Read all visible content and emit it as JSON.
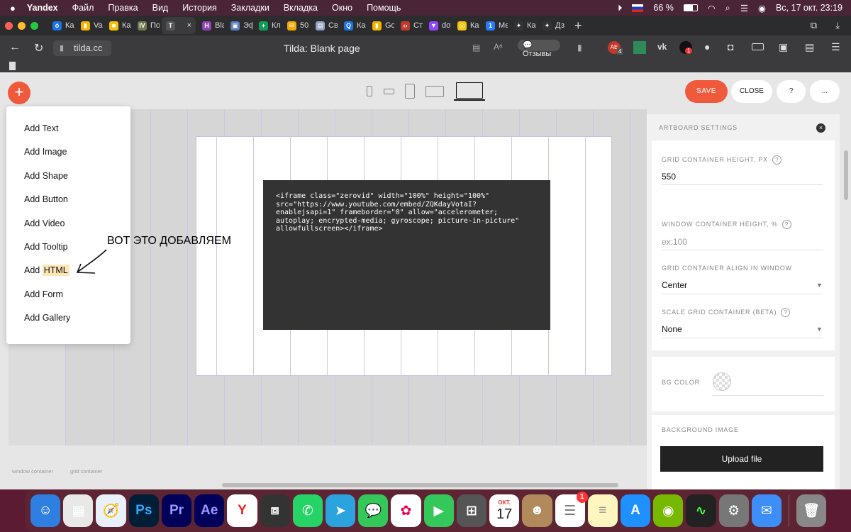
{
  "menubar": {
    "app": "Yandex",
    "items": [
      "Файл",
      "Правка",
      "Вид",
      "История",
      "Закладки",
      "Вкладка",
      "Окно",
      "Помощь"
    ],
    "battery": "66 %",
    "clock": "Вс, 17 окт.  23:19"
  },
  "tabs": [
    {
      "label": "Ка",
      "color": "#1a73e8",
      "glyph": "ó"
    },
    {
      "label": "Vac",
      "color": "#f4b400",
      "glyph": "▮"
    },
    {
      "label": "Ка",
      "color": "#f4c20d",
      "glyph": "■"
    },
    {
      "label": "По",
      "color": "#6d7a4a",
      "glyph": "IV"
    },
    {
      "label": "",
      "color": "#555",
      "glyph": "T",
      "active": true
    },
    {
      "label": "Bla",
      "color": "#8e44ad",
      "glyph": "H"
    },
    {
      "label": "Эф",
      "color": "#5b7db8",
      "glyph": "▣"
    },
    {
      "label": "Кл",
      "color": "#0f9d58",
      "glyph": "+"
    },
    {
      "label": "50",
      "color": "#f2a900",
      "glyph": "✉"
    },
    {
      "label": "Сво",
      "color": "#8fa3c2",
      "glyph": "▤"
    },
    {
      "label": "Ка",
      "color": "#1a73e8",
      "glyph": "Q"
    },
    {
      "label": "Go",
      "color": "#f4b400",
      "glyph": "▮"
    },
    {
      "label": "Ста",
      "color": "#c0392b",
      "glyph": "‹›"
    },
    {
      "label": "dot",
      "color": "#9146ff",
      "glyph": "▼"
    },
    {
      "label": "Ка",
      "color": "#f4c20d",
      "glyph": "◎"
    },
    {
      "label": "Ме",
      "color": "#2979ff",
      "glyph": "1"
    },
    {
      "label": "Ка",
      "color": "#333",
      "glyph": "✦"
    },
    {
      "label": "Дз",
      "color": "#333",
      "glyph": "✦"
    }
  ],
  "address": {
    "url": "tilda.cc",
    "title": "Tilda: Blank page",
    "reviews": "Отзывы"
  },
  "ext_badges": {
    "ae": "4",
    "ext2": "1"
  },
  "app": {
    "save": "SAVE",
    "close": "CLOSE",
    "help": "?",
    "more": "...",
    "add_menu": [
      "Add Text",
      "Add Image",
      "Add Shape",
      "Add Button",
      "Add Video",
      "Add Tooltip",
      "Add HTML",
      "Add Form",
      "Add Gallery"
    ],
    "add_html_prefix": "Add ",
    "add_html_highlight": "HTML",
    "annotation": "ВОТ ЭТО ДОБАВЛЯЕМ",
    "code": "<iframe class=\"zerovid\" width=\"100%\" height=\"100%\"\nsrc=\"https://www.youtube.com/embed/ZQKdayVotaI?\nenablejsapi=1\" frameborder=\"0\" allow=\"accelerometer;\nautoplay; encrypted-media; gyroscope; picture-in-picture\"\nallowfullscreen></iframe>",
    "bottom_label_1": "window container",
    "bottom_label_2": "grid container"
  },
  "settings": {
    "title": "ARTBOARD SETTINGS",
    "grid_height_label": "GRID CONTAINER HEIGHT, PX",
    "grid_height_value": "550",
    "window_height_label": "WINDOW CONTAINER HEIGHT, %",
    "window_height_placeholder": "ex:100",
    "align_label": "GRID CONTAINER ALIGN IN WINDOW",
    "align_value": "Center",
    "scale_label": "SCALE GRID CONTAINER (BETA)",
    "scale_value": "None",
    "bg_color_label": "BG COLOR",
    "bg_image_label": "BACKGROUND IMAGE",
    "upload": "Upload file"
  },
  "dock": {
    "calendar_month": "ОКТ.",
    "calendar_day": "17",
    "reminders_badge": "1",
    "icons": [
      {
        "name": "finder-icon",
        "bg": "#2f7fe0",
        "glyph": "☺"
      },
      {
        "name": "launchpad-icon",
        "bg": "#e8e8e8",
        "glyph": "▦"
      },
      {
        "name": "safari-icon",
        "bg": "#e8f1fb",
        "glyph": "🧭"
      },
      {
        "name": "photoshop-icon",
        "bg": "#001e36",
        "glyph": "Ps",
        "fg": "#31a8ff"
      },
      {
        "name": "premiere-icon",
        "bg": "#00005b",
        "glyph": "Pr",
        "fg": "#9999ff"
      },
      {
        "name": "after-effects-icon",
        "bg": "#00005b",
        "glyph": "Ae",
        "fg": "#9999ff"
      },
      {
        "name": "yandex-browser-icon",
        "bg": "#ffffff",
        "glyph": "Y",
        "fg": "#e22"
      },
      {
        "name": "parallels-icon",
        "bg": "#333",
        "glyph": "⧈"
      },
      {
        "name": "whatsapp-icon",
        "bg": "#25d366",
        "glyph": "✆"
      },
      {
        "name": "telegram-icon",
        "bg": "#2aa3df",
        "glyph": "➤"
      },
      {
        "name": "messages-icon",
        "bg": "#34c759",
        "glyph": "💬"
      },
      {
        "name": "photos-icon",
        "bg": "#fff",
        "glyph": "✿",
        "fg": "#e05"
      },
      {
        "name": "facetime-icon",
        "bg": "#34c759",
        "glyph": "▶"
      },
      {
        "name": "calculator-icon",
        "bg": "#555",
        "glyph": "⊞"
      },
      {
        "name": "calendar-icon",
        "bg": "#fff",
        "glyph": ""
      },
      {
        "name": "contacts-icon",
        "bg": "#b08a5a",
        "glyph": "☻"
      },
      {
        "name": "reminders-icon",
        "bg": "#fff",
        "glyph": "☰",
        "fg": "#777"
      },
      {
        "name": "notes-icon",
        "bg": "#fff6bf",
        "glyph": "≡",
        "fg": "#999"
      },
      {
        "name": "app-store-icon",
        "bg": "#1e90ff",
        "glyph": "A"
      },
      {
        "name": "nvidia-icon",
        "bg": "#76b900",
        "glyph": "◉"
      },
      {
        "name": "activity-monitor-icon",
        "bg": "#222",
        "glyph": "∿",
        "fg": "#4f4"
      },
      {
        "name": "system-preferences-icon",
        "bg": "#777",
        "glyph": "⚙"
      },
      {
        "name": "mail-icon",
        "bg": "#3d8ef7",
        "glyph": "✉"
      },
      {
        "name": "trash-icon",
        "bg": "#888",
        "glyph": "🗑"
      }
    ]
  }
}
